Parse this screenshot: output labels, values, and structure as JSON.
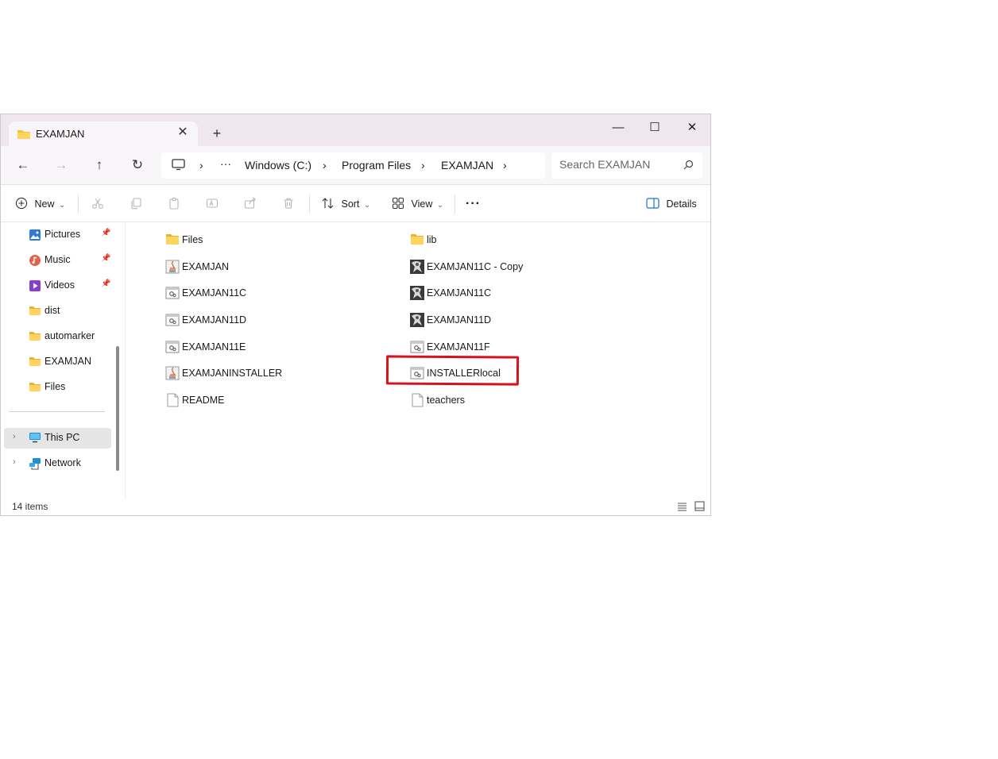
{
  "window": {
    "tab_title": "EXAMJAN",
    "tab_close": "✕",
    "new_tab": "+",
    "minimize": "—",
    "maximize": "☐",
    "close": "✕"
  },
  "nav": {
    "back": "←",
    "forward": "→",
    "up": "↑",
    "refresh": "↻",
    "breadcrumb": [
      "Windows (C:)",
      "Program Files",
      "EXAMJAN"
    ],
    "more": "···",
    "separator": "›",
    "search_placeholder": "Search EXAMJAN"
  },
  "toolbar": {
    "new_label": "New",
    "sort_label": "Sort",
    "view_label": "View",
    "more_label": "···",
    "details_label": "Details",
    "dropdown_glyph": "⌄"
  },
  "sidebar": {
    "items": [
      {
        "label": "Pictures",
        "icon": "pictures-icon",
        "pinned": true
      },
      {
        "label": "Music",
        "icon": "music-icon",
        "pinned": true
      },
      {
        "label": "Videos",
        "icon": "videos-icon",
        "pinned": true
      },
      {
        "label": "dist",
        "icon": "folder-icon",
        "pinned": false
      },
      {
        "label": "automarker",
        "icon": "folder-icon",
        "pinned": false
      },
      {
        "label": "EXAMJAN",
        "icon": "folder-icon",
        "pinned": false
      },
      {
        "label": "Files",
        "icon": "folder-icon",
        "pinned": false
      }
    ],
    "this_pc": "This PC",
    "network": "Network",
    "expand_glyph": "›",
    "pin_glyph": "📌"
  },
  "files": {
    "left": [
      {
        "name": "Files",
        "icon": "folder-icon"
      },
      {
        "name": "EXAMJAN",
        "icon": "java-icon"
      },
      {
        "name": "EXAMJAN11C",
        "icon": "shortcut-icon"
      },
      {
        "name": "EXAMJAN11D",
        "icon": "shortcut-icon"
      },
      {
        "name": "EXAMJAN11E",
        "icon": "shortcut-icon"
      },
      {
        "name": "EXAMJANINSTALLER",
        "icon": "java-icon"
      },
      {
        "name": "README",
        "icon": "file-icon"
      }
    ],
    "right": [
      {
        "name": "lib",
        "icon": "folder-icon"
      },
      {
        "name": "EXAMJAN11C - Copy",
        "icon": "app-image-icon"
      },
      {
        "name": "EXAMJAN11C",
        "icon": "app-image-icon"
      },
      {
        "name": "EXAMJAN11D",
        "icon": "app-image-icon"
      },
      {
        "name": "EXAMJAN11F",
        "icon": "shortcut-icon"
      },
      {
        "name": "INSTALLERlocal",
        "icon": "shortcut-icon"
      },
      {
        "name": "teachers",
        "icon": "file-icon"
      }
    ]
  },
  "status": {
    "item_count": "14 items"
  },
  "colors": {
    "highlight": "#d7121b",
    "folder": "#f5c33b",
    "titlebar": "#efe6ee"
  }
}
